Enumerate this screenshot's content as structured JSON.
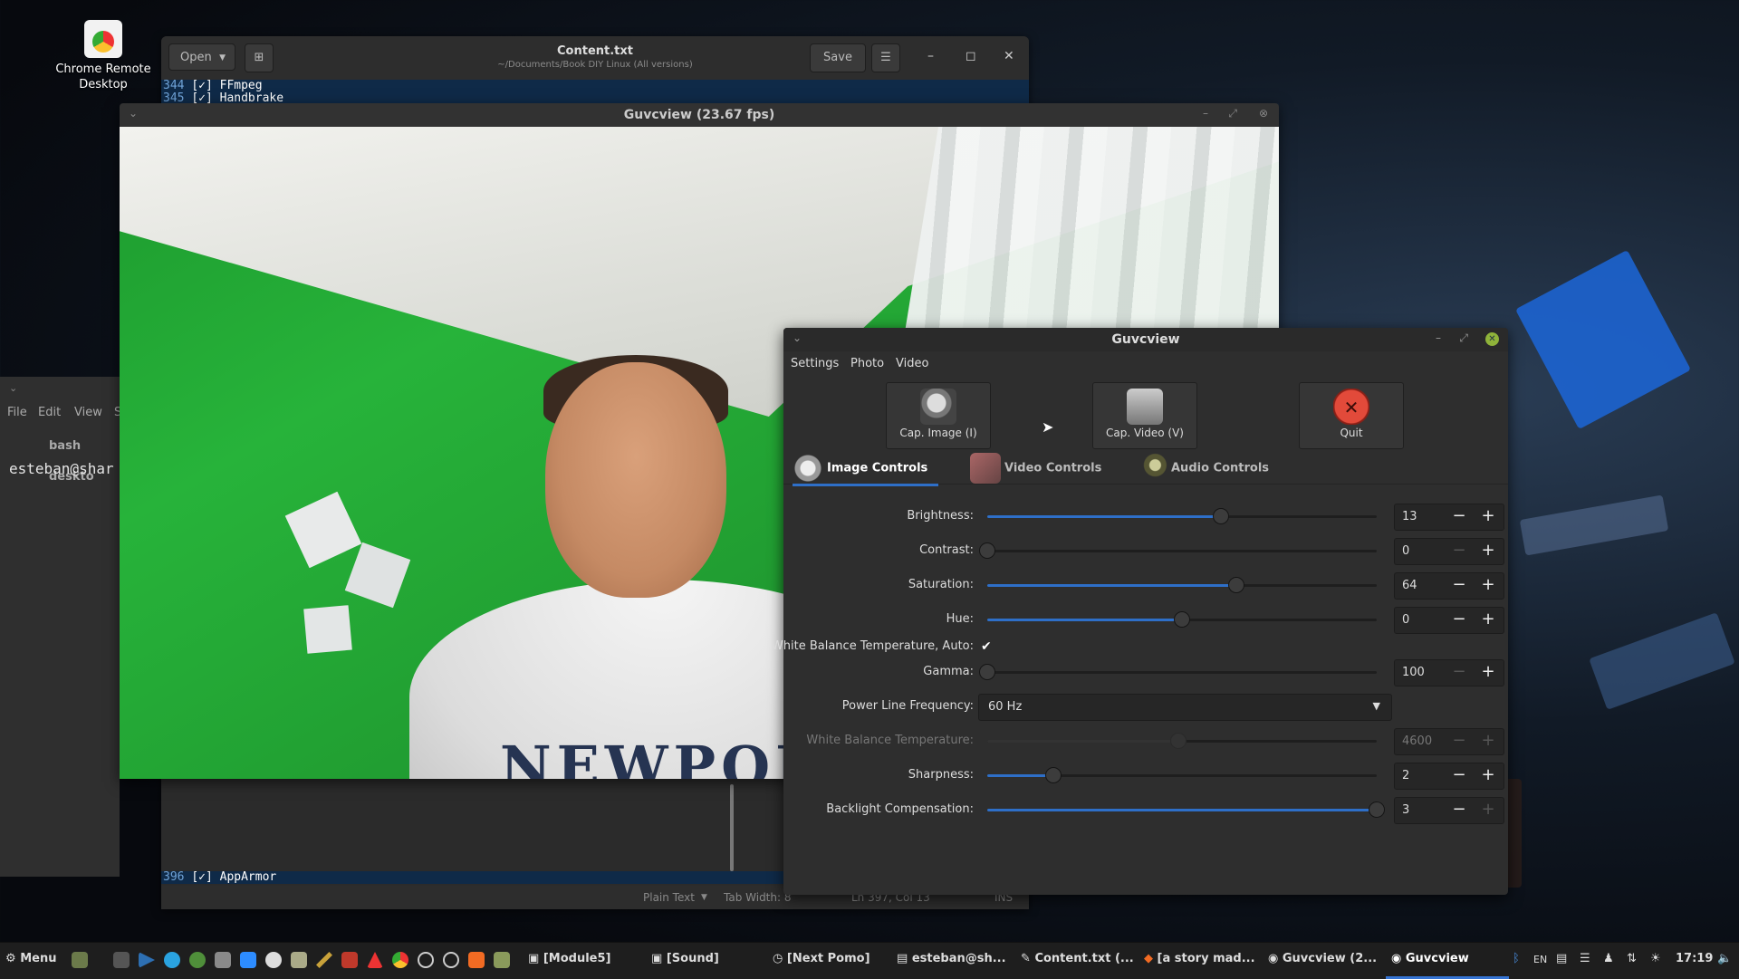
{
  "desktop": {
    "icon_label_line1": "Chrome Remote",
    "icon_label_line2": "Desktop"
  },
  "editor": {
    "open_label": "Open",
    "title": "Content.txt",
    "subtitle": "~/Documents/Book DIY Linux (All versions)",
    "save_label": "Save",
    "lines": [
      {
        "num": "344",
        "text": "[✓] FFmpeg"
      },
      {
        "num": "345",
        "text": "[✓] Handbrake"
      },
      {
        "num": "396",
        "text": "[✓] AppArmor"
      }
    ],
    "status_lang": "Plain Text",
    "status_tab": "Tab Width: 8",
    "status_pos": "Ln 397, Col 13",
    "status_ins": "INS"
  },
  "terminal": {
    "menu": [
      "File",
      "Edit",
      "View",
      "S"
    ],
    "tab_title": "bash deskto",
    "prompt": "esteban@shar"
  },
  "preview": {
    "title": "Guvcview  (23.67 fps)",
    "shirt_text": "NEWPORT"
  },
  "control": {
    "title": "Guvcview",
    "menu": [
      "Settings",
      "Photo",
      "Video"
    ],
    "buttons": {
      "cap_image": "Cap. Image (I)",
      "cap_video": "Cap. Video (V)",
      "quit": "Quit"
    },
    "tabs": [
      "Image Controls",
      "Video Controls",
      "Audio Controls"
    ],
    "controls": {
      "brightness": {
        "label": "Brightness:",
        "value": "13",
        "level": 0.6
      },
      "contrast": {
        "label": "Contrast:",
        "value": "0",
        "level": 0.0
      },
      "saturation": {
        "label": "Saturation:",
        "value": "64",
        "level": 0.64
      },
      "hue": {
        "label": "Hue:",
        "value": "0",
        "level": 0.5
      },
      "wb_auto": {
        "label": "White Balance Temperature, Auto:",
        "checked": true
      },
      "gamma": {
        "label": "Gamma:",
        "value": "100",
        "level": 0.0
      },
      "power_line": {
        "label": "Power Line Frequency:",
        "value": "60 Hz"
      },
      "wb_temp": {
        "label": "White Balance Temperature:",
        "value": "4600",
        "level": 0.49
      },
      "sharpness": {
        "label": "Sharpness:",
        "value": "2",
        "level": 0.17
      },
      "backlight": {
        "label": "Backlight Compensation:",
        "value": "3",
        "level": 1.0
      }
    },
    "minus": "−",
    "plus": "+"
  },
  "taskbar": {
    "menu_label": "Menu",
    "items": [
      "[Module5]",
      "[Sound]",
      "[Next Pomo]",
      "esteban@sh...",
      "Content.txt (...",
      "[a story mad...",
      "Guvcview  (2...",
      "Guvcview"
    ],
    "lang": "EN",
    "clock": "17:19"
  },
  "colors": {
    "accent": "#2e6fc8",
    "quit_red": "#e24a3a",
    "window_bg": "#2e2e2e"
  }
}
